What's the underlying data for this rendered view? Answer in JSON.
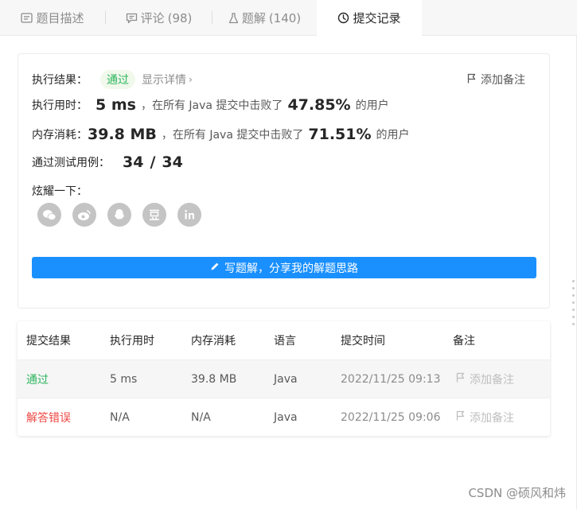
{
  "tabs": [
    {
      "label": "题目描述",
      "count": "",
      "icon": "document-icon"
    },
    {
      "label": "评论",
      "count": "(98)",
      "icon": "comment-icon"
    },
    {
      "label": "题解",
      "count": "(140)",
      "icon": "flask-icon"
    },
    {
      "label": "提交记录",
      "count": "",
      "icon": "clock-icon"
    }
  ],
  "result": {
    "exec_result_label": "执行结果：",
    "status": "通过",
    "detail_link": "显示详情",
    "add_note": "添加备注",
    "time_label": "执行用时：",
    "time_value": "5 ms",
    "time_mid": "，在所有 Java 提交中击败了",
    "time_pct": "47.85%",
    "suffix": "的用户",
    "mem_label": "内存消耗：",
    "mem_value": "39.8 MB",
    "mem_mid": "，在所有 Java 提交中击败了",
    "mem_pct": "71.51%",
    "tests_label": "通过测试用例：",
    "tests_passed": "34",
    "tests_sep": "/",
    "tests_total": "34",
    "share_label": "炫耀一下：",
    "share_icons": [
      "wechat-icon",
      "weibo-icon",
      "qq-icon",
      "douban-icon",
      "linkedin-icon"
    ],
    "write_button": "写题解，分享我的解题思路"
  },
  "table": {
    "headers": [
      "提交结果",
      "执行用时",
      "内存消耗",
      "语言",
      "提交时间",
      "备注"
    ],
    "rows": [
      {
        "result": "通过",
        "time": "5 ms",
        "memory": "39.8 MB",
        "lang": "Java",
        "submitted": "2022/11/25 09:13",
        "note": "添加备注"
      },
      {
        "result": "解答错误",
        "time": "N/A",
        "memory": "N/A",
        "lang": "Java",
        "submitted": "2022/11/25 09:06",
        "note": "添加备注"
      }
    ]
  },
  "watermark": "CSDN @硕风和炜",
  "colors": {
    "accent": "#1a90ff",
    "success": "#2db55d",
    "error": "#ef4743"
  }
}
